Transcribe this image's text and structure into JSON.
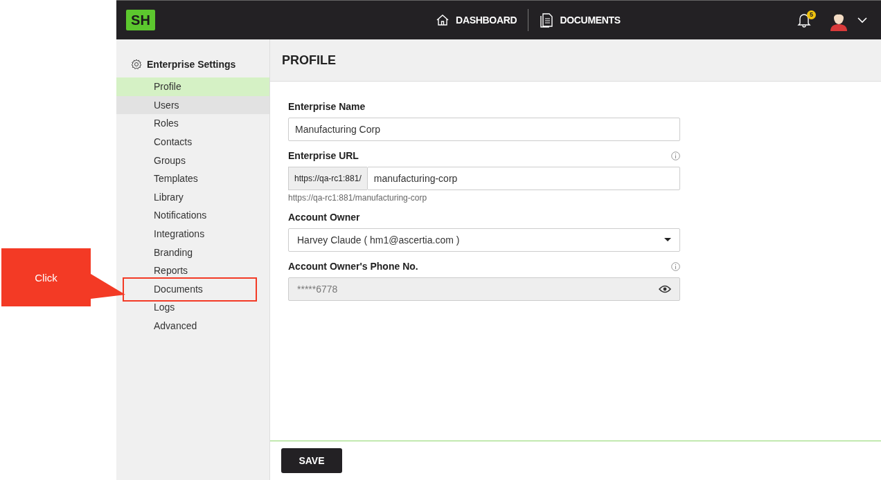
{
  "topbar": {
    "logo": "SH",
    "nav": [
      {
        "label": "DASHBOARD"
      },
      {
        "label": "DOCUMENTS"
      }
    ],
    "notification_count": "5"
  },
  "sidebar": {
    "title": "Enterprise Settings",
    "items": [
      {
        "label": "Profile",
        "selected": true,
        "hovered": false
      },
      {
        "label": "Users",
        "selected": false,
        "hovered": true
      },
      {
        "label": "Roles",
        "selected": false,
        "hovered": false
      },
      {
        "label": "Contacts",
        "selected": false,
        "hovered": false
      },
      {
        "label": "Groups",
        "selected": false,
        "hovered": false
      },
      {
        "label": "Templates",
        "selected": false,
        "hovered": false
      },
      {
        "label": "Library",
        "selected": false,
        "hovered": false
      },
      {
        "label": "Notifications",
        "selected": false,
        "hovered": false
      },
      {
        "label": "Integrations",
        "selected": false,
        "hovered": false
      },
      {
        "label": "Branding",
        "selected": false,
        "hovered": false
      },
      {
        "label": "Reports",
        "selected": false,
        "hovered": false
      },
      {
        "label": "Documents",
        "selected": false,
        "hovered": false
      },
      {
        "label": "Logs",
        "selected": false,
        "hovered": false
      },
      {
        "label": "Advanced",
        "selected": false,
        "hovered": false
      }
    ]
  },
  "page": {
    "title": "PROFILE",
    "fields": [
      {
        "kind": "text",
        "label": "Enterprise Name",
        "value": "Manufacturing Corp"
      },
      {
        "kind": "prefixed",
        "label": "Enterprise URL",
        "info": true,
        "prefix": "https://qa-rc1:881/",
        "value": "manufacturing-corp",
        "hint": "https://qa-rc1:881/manufacturing-corp"
      },
      {
        "kind": "select",
        "label": "Account Owner",
        "value": "Harvey Claude ( hm1@ascertia.com )"
      },
      {
        "kind": "masked",
        "label": "Account Owner's Phone No.",
        "info": true,
        "value": "*****6778",
        "disabled": true
      }
    ],
    "save_button": "SAVE"
  },
  "annotation": {
    "callout": "Click"
  }
}
